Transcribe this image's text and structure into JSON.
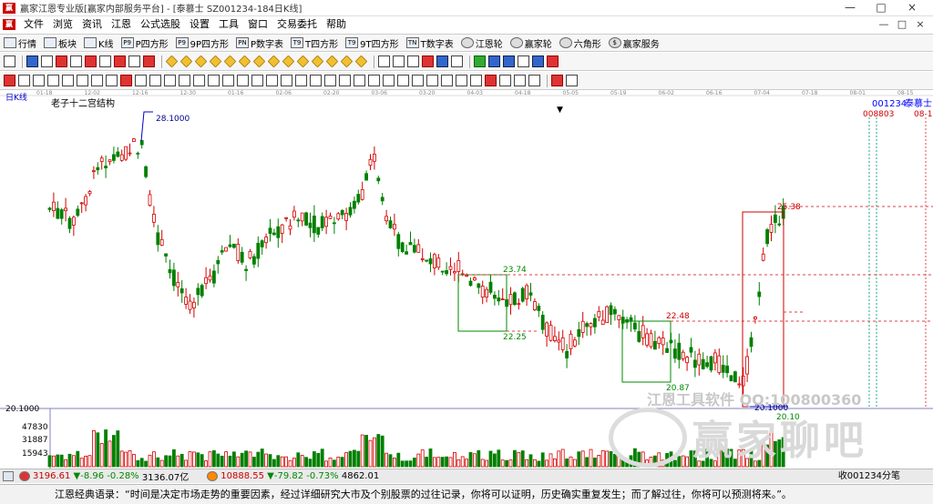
{
  "window": {
    "title": "赢家江恩专业版[赢家内部服务平台] - [泰慕士  SZ001234-184日K线]",
    "min": "—",
    "max": "□",
    "close": "×"
  },
  "menu": {
    "icon": "赢",
    "items": [
      "文件",
      "浏览",
      "资讯",
      "江恩",
      "公式选股",
      "设置",
      "工具",
      "窗口",
      "交易委托",
      "帮助"
    ],
    "right": [
      "—",
      "□",
      "×"
    ]
  },
  "toolbar": {
    "items": [
      {
        "label": "行情",
        "icon": "grid-icon"
      },
      {
        "label": "板块",
        "icon": "blocks-icon"
      },
      {
        "label": "K线",
        "icon": "kline-icon"
      },
      {
        "label": "P四方形",
        "icon": "p-square-icon"
      },
      {
        "label": "9P四方形",
        "icon": "9p-square-icon"
      },
      {
        "label": "P数字表",
        "icon": "p-table-icon"
      },
      {
        "label": "T四方形",
        "icon": "t-square-icon"
      },
      {
        "label": "9T四方形",
        "icon": "9t-square-icon"
      },
      {
        "label": "T数字表",
        "icon": "t-table-icon"
      },
      {
        "label": "江恩轮",
        "icon": "gann-wheel-icon"
      },
      {
        "label": "赢家轮",
        "icon": "winner-wheel-icon"
      },
      {
        "label": "六角形",
        "icon": "hexagon-icon"
      },
      {
        "label": "赢家服务",
        "icon": "dollar-icon"
      }
    ]
  },
  "chart": {
    "period_label": "日K线",
    "indicator_label": "老子十二宫结构",
    "stock_code": "001234",
    "stock_name": "泰慕士",
    "right_code": "008803",
    "right_code2": "08-1",
    "date_ticks": [
      "01-18",
      "12-02",
      "12-16",
      "12-30",
      "01-16",
      "02-06",
      "02-20",
      "03-06",
      "03-20",
      "04-03",
      "04-18",
      "05-05",
      "05-19",
      "06-02",
      "06-16",
      "07-04",
      "07-18",
      "08-01",
      "08-15"
    ],
    "price_labels": {
      "high": "28.1000",
      "low": "20.1000",
      "last": "25.38",
      "box1_top": "23.74",
      "box1_bottom": "22.25",
      "box2_top": "22.48",
      "box2_bottom": "20.87",
      "marker": "20.10"
    },
    "axis": {
      "price_base": "20.1000",
      "vol_ticks": [
        "47830",
        "31887",
        "15943"
      ]
    },
    "watermark1": "江恩工具软件  QQ:100800360",
    "watermark2": "赢家聊吧",
    "colors": {
      "up": "#d40000",
      "down": "#008000",
      "box": "#c00000",
      "dash": "#e04040",
      "axis": "#8080c0"
    }
  },
  "chart_data": {
    "type": "candlestick",
    "price_ylim": [
      20.1,
      28.1
    ],
    "candles": []
  },
  "status": {
    "sh_index": "3196.61",
    "sh_change": "▼-8.96",
    "sh_pct": "-0.28%",
    "sh_amount": "3136.07亿",
    "sz_index": "10888.55",
    "sz_change": "▼-79.82",
    "sz_pct": "-0.73%",
    "sz_amount": "4862.01",
    "right_text": "收001234分笔"
  },
  "quote": {
    "text": "江恩经典语录：“时间是决定市场走势的重要因素，经过详细研究大市及个别股票的过往记录，你将可以证明，历史确实重复发生；而了解过往，你将可以预测将来。”。"
  }
}
